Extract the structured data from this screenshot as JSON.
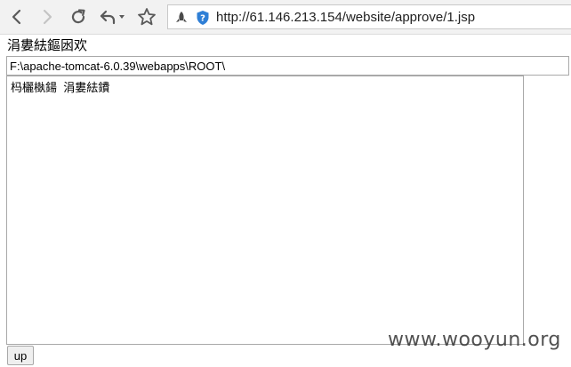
{
  "browser": {
    "url": "http://61.146.213.154/website/approve/1.jsp",
    "icons": [
      "back-icon",
      "forward-icon",
      "reload-icon",
      "reply-icon",
      "dropdown-caret-icon",
      "bookmark-star-icon",
      "extension-rocket-icon",
      "security-shield-icon"
    ]
  },
  "page": {
    "heading": "涓婁紶鏂囦欢",
    "path_value": "F:\\apache-tomcat-6.0.39\\webapps\\ROOT\\",
    "textarea_value": "杩欐槸鍚  涓婁紶鐨",
    "upload_button_label": "up"
  },
  "watermark": {
    "text": "www.wooyun.org"
  }
}
